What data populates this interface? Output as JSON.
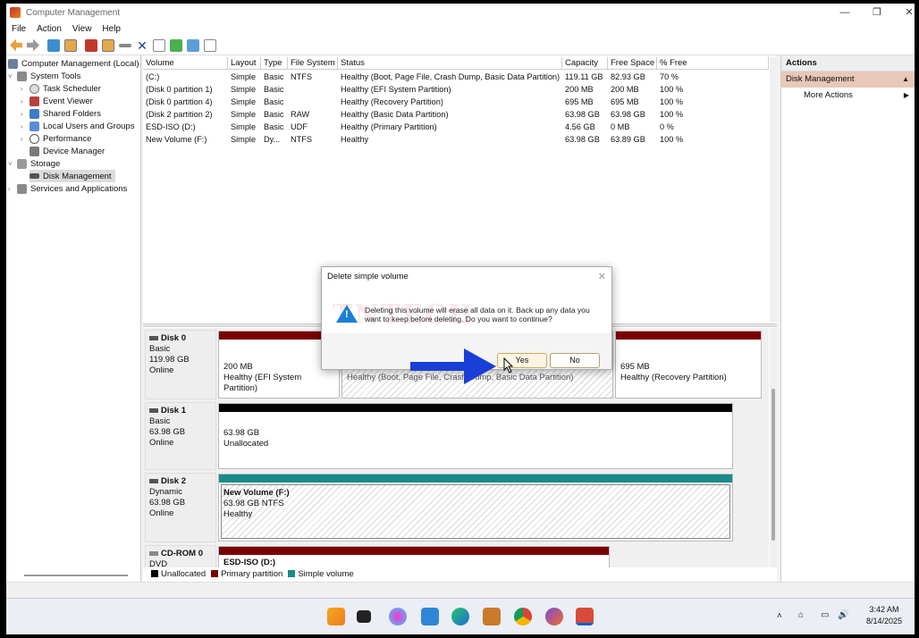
{
  "window": {
    "title": "Computer Management",
    "controls": {
      "minimize": "—",
      "maximize": "❐",
      "close": "✕"
    }
  },
  "menu": [
    "File",
    "Action",
    "View",
    "Help"
  ],
  "tree": {
    "root": "Computer Management (Local)",
    "system_tools": "System Tools",
    "task_scheduler": "Task Scheduler",
    "event_viewer": "Event Viewer",
    "shared_folders": "Shared Folders",
    "local_users": "Local Users and Groups",
    "performance": "Performance",
    "device_manager": "Device Manager",
    "storage": "Storage",
    "disk_management": "Disk Management",
    "services": "Services and Applications"
  },
  "volumes": {
    "columns": [
      "Volume",
      "Layout",
      "Type",
      "File System",
      "Status",
      "Capacity",
      "Free Space",
      "% Free"
    ],
    "rows": [
      [
        "(C:)",
        "Simple",
        "Basic",
        "NTFS",
        "Healthy (Boot, Page File, Crash Dump, Basic Data Partition)",
        "119.11 GB",
        "82.93 GB",
        "70 %"
      ],
      [
        "(Disk 0 partition 1)",
        "Simple",
        "Basic",
        "",
        "Healthy (EFI System Partition)",
        "200 MB",
        "200 MB",
        "100 %"
      ],
      [
        "(Disk 0 partition 4)",
        "Simple",
        "Basic",
        "",
        "Healthy (Recovery Partition)",
        "695 MB",
        "695 MB",
        "100 %"
      ],
      [
        "(Disk 2 partition 2)",
        "Simple",
        "Basic",
        "RAW",
        "Healthy (Basic Data Partition)",
        "63.98 GB",
        "63.98 GB",
        "100 %"
      ],
      [
        "ESD-ISO (D:)",
        "Simple",
        "Basic",
        "UDF",
        "Healthy (Primary Partition)",
        "4.56 GB",
        "0 MB",
        "0 %"
      ],
      [
        "New Volume (F:)",
        "Simple",
        "Dy...",
        "NTFS",
        "Healthy",
        "63.98 GB",
        "63.89 GB",
        "100 %"
      ]
    ]
  },
  "disks": {
    "disk0": {
      "name": "Disk 0",
      "type": "Basic",
      "size": "119.98 GB",
      "status": "Online",
      "p1_size": "200 MB",
      "p1_status": "Healthy (EFI System Partition)",
      "p2_status": "Healthy (Boot, Page File, Crash Dump, Basic Data Partition)",
      "p3_size": "695 MB",
      "p3_status": "Healthy (Recovery Partition)"
    },
    "disk1": {
      "name": "Disk 1",
      "type": "Basic",
      "size": "63.98 GB",
      "status": "Online",
      "p1_size": "63.98 GB",
      "p1_status": "Unallocated"
    },
    "disk2": {
      "name": "Disk 2",
      "type": "Dynamic",
      "size": "63.98 GB",
      "status": "Online",
      "p1_name": "New Volume  (F:)",
      "p1_size": "63.98 GB NTFS",
      "p1_status": "Healthy"
    },
    "cdrom0": {
      "name": "CD-ROM 0",
      "type": "DVD",
      "p1_name": "ESD-ISO  (D:)"
    }
  },
  "legend": {
    "unallocated": "Unallocated",
    "primary": "Primary partition",
    "simple": "Simple volume"
  },
  "colors": {
    "unallocated": "#000000",
    "primary": "#7a0000",
    "simple": "#1a8a8a",
    "accent_arrow": "#1a3fd6"
  },
  "actions": {
    "header": "Actions",
    "section": "Disk Management",
    "more": "More Actions"
  },
  "dialog": {
    "title": "Delete simple volume",
    "message": "Deleting this volume will erase all data on it. Back up any data you want to keep before deleting. Do you want to continue?",
    "yes": "Yes",
    "no": "No",
    "watermark": "TNTECH"
  },
  "taskbar": {
    "time": "3:42 AM",
    "date": "8/14/2025"
  }
}
